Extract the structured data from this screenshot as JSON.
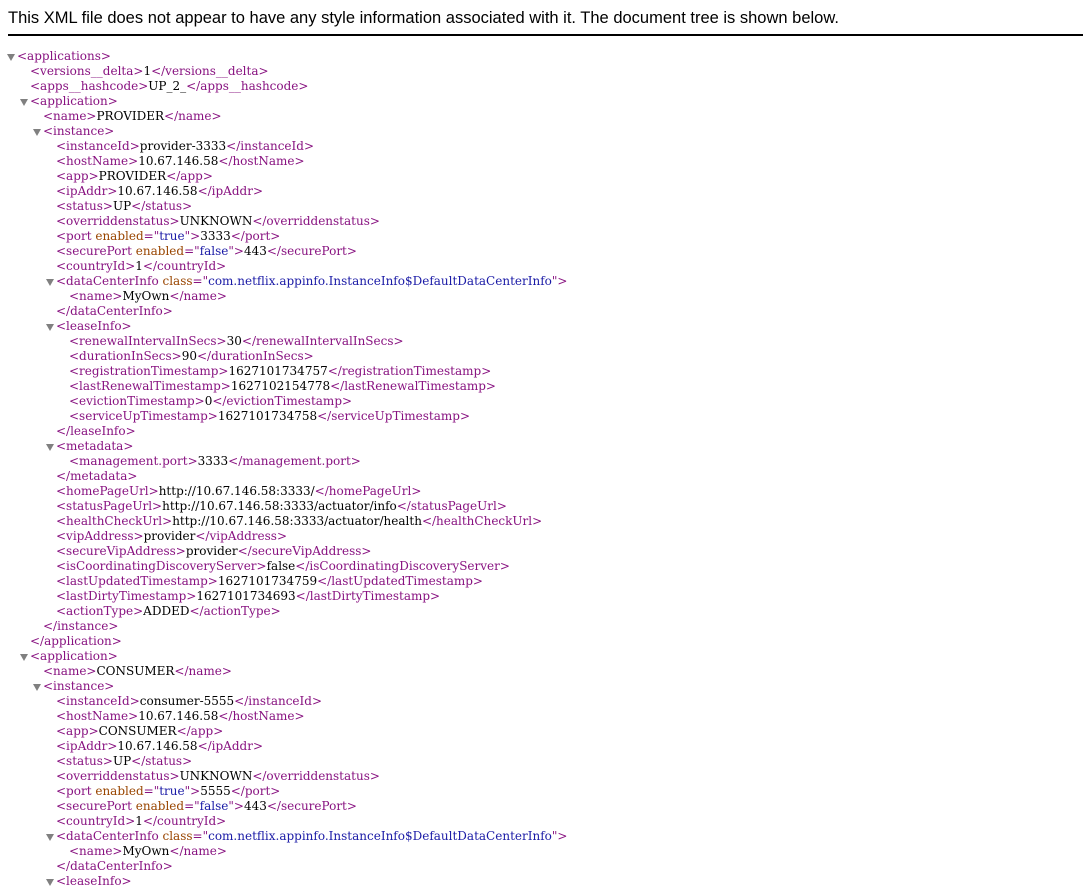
{
  "header": {
    "message": "This XML file does not appear to have any style information associated with it. The document tree is shown below."
  },
  "lines": [
    {
      "indent": 0,
      "toggle": true,
      "name": "applications-open",
      "parts": [
        {
          "c": "t",
          "s": "<applications>"
        }
      ]
    },
    {
      "indent": 1,
      "toggle": false,
      "name": "versions-delta",
      "parts": [
        {
          "c": "t",
          "s": "<versions__delta>"
        },
        {
          "c": "x",
          "s": "1"
        },
        {
          "c": "t",
          "s": "</versions__delta>"
        }
      ]
    },
    {
      "indent": 1,
      "toggle": false,
      "name": "apps-hashcode",
      "parts": [
        {
          "c": "t",
          "s": "<apps__hashcode>"
        },
        {
          "c": "x",
          "s": "UP_2_"
        },
        {
          "c": "t",
          "s": "</apps__hashcode>"
        }
      ]
    },
    {
      "indent": 1,
      "toggle": true,
      "name": "application-open",
      "parts": [
        {
          "c": "t",
          "s": "<application>"
        }
      ]
    },
    {
      "indent": 2,
      "toggle": false,
      "name": "name",
      "parts": [
        {
          "c": "t",
          "s": "<name>"
        },
        {
          "c": "x",
          "s": "PROVIDER"
        },
        {
          "c": "t",
          "s": "</name>"
        }
      ]
    },
    {
      "indent": 2,
      "toggle": true,
      "name": "instance-open",
      "parts": [
        {
          "c": "t",
          "s": "<instance>"
        }
      ]
    },
    {
      "indent": 3,
      "toggle": false,
      "name": "instance-id",
      "parts": [
        {
          "c": "t",
          "s": "<instanceId>"
        },
        {
          "c": "x",
          "s": "provider-3333"
        },
        {
          "c": "t",
          "s": "</instanceId>"
        }
      ]
    },
    {
      "indent": 3,
      "toggle": false,
      "name": "host-name",
      "parts": [
        {
          "c": "t",
          "s": "<hostName>"
        },
        {
          "c": "x",
          "s": "10.67.146.58"
        },
        {
          "c": "t",
          "s": "</hostName>"
        }
      ]
    },
    {
      "indent": 3,
      "toggle": false,
      "name": "app",
      "parts": [
        {
          "c": "t",
          "s": "<app>"
        },
        {
          "c": "x",
          "s": "PROVIDER"
        },
        {
          "c": "t",
          "s": "</app>"
        }
      ]
    },
    {
      "indent": 3,
      "toggle": false,
      "name": "ip-addr",
      "parts": [
        {
          "c": "t",
          "s": "<ipAddr>"
        },
        {
          "c": "x",
          "s": "10.67.146.58"
        },
        {
          "c": "t",
          "s": "</ipAddr>"
        }
      ]
    },
    {
      "indent": 3,
      "toggle": false,
      "name": "status",
      "parts": [
        {
          "c": "t",
          "s": "<status>"
        },
        {
          "c": "x",
          "s": "UP"
        },
        {
          "c": "t",
          "s": "</status>"
        }
      ]
    },
    {
      "indent": 3,
      "toggle": false,
      "name": "overridden-status",
      "parts": [
        {
          "c": "t",
          "s": "<overriddenstatus>"
        },
        {
          "c": "x",
          "s": "UNKNOWN"
        },
        {
          "c": "t",
          "s": "</overriddenstatus>"
        }
      ]
    },
    {
      "indent": 3,
      "toggle": false,
      "name": "port",
      "parts": [
        {
          "c": "t",
          "s": "<port"
        },
        {
          "c": "a",
          "s": " enabled"
        },
        {
          "c": "t",
          "s": "=\""
        },
        {
          "c": "v",
          "s": "true"
        },
        {
          "c": "t",
          "s": "\">"
        },
        {
          "c": "x",
          "s": "3333"
        },
        {
          "c": "t",
          "s": "</port>"
        }
      ]
    },
    {
      "indent": 3,
      "toggle": false,
      "name": "secure-port",
      "parts": [
        {
          "c": "t",
          "s": "<securePort"
        },
        {
          "c": "a",
          "s": " enabled"
        },
        {
          "c": "t",
          "s": "=\""
        },
        {
          "c": "v",
          "s": "false"
        },
        {
          "c": "t",
          "s": "\">"
        },
        {
          "c": "x",
          "s": "443"
        },
        {
          "c": "t",
          "s": "</securePort>"
        }
      ]
    },
    {
      "indent": 3,
      "toggle": false,
      "name": "country-id",
      "parts": [
        {
          "c": "t",
          "s": "<countryId>"
        },
        {
          "c": "x",
          "s": "1"
        },
        {
          "c": "t",
          "s": "</countryId>"
        }
      ]
    },
    {
      "indent": 3,
      "toggle": true,
      "name": "data-center-info-open",
      "parts": [
        {
          "c": "t",
          "s": "<dataCenterInfo"
        },
        {
          "c": "a",
          "s": " class"
        },
        {
          "c": "t",
          "s": "=\""
        },
        {
          "c": "v",
          "s": "com.netflix.appinfo.InstanceInfo$DefaultDataCenterInfo"
        },
        {
          "c": "t",
          "s": "\">"
        }
      ]
    },
    {
      "indent": 4,
      "toggle": false,
      "name": "data-center-name",
      "parts": [
        {
          "c": "t",
          "s": "<name>"
        },
        {
          "c": "x",
          "s": "MyOwn"
        },
        {
          "c": "t",
          "s": "</name>"
        }
      ]
    },
    {
      "indent": 3,
      "toggle": false,
      "name": "data-center-info-close",
      "parts": [
        {
          "c": "t",
          "s": "</dataCenterInfo>"
        }
      ]
    },
    {
      "indent": 3,
      "toggle": true,
      "name": "lease-info-open",
      "parts": [
        {
          "c": "t",
          "s": "<leaseInfo>"
        }
      ]
    },
    {
      "indent": 4,
      "toggle": false,
      "name": "renewal-interval",
      "parts": [
        {
          "c": "t",
          "s": "<renewalIntervalInSecs>"
        },
        {
          "c": "x",
          "s": "30"
        },
        {
          "c": "t",
          "s": "</renewalIntervalInSecs>"
        }
      ]
    },
    {
      "indent": 4,
      "toggle": false,
      "name": "duration",
      "parts": [
        {
          "c": "t",
          "s": "<durationInSecs>"
        },
        {
          "c": "x",
          "s": "90"
        },
        {
          "c": "t",
          "s": "</durationInSecs>"
        }
      ]
    },
    {
      "indent": 4,
      "toggle": false,
      "name": "registration-timestamp",
      "parts": [
        {
          "c": "t",
          "s": "<registrationTimestamp>"
        },
        {
          "c": "x",
          "s": "1627101734757"
        },
        {
          "c": "t",
          "s": "</registrationTimestamp>"
        }
      ]
    },
    {
      "indent": 4,
      "toggle": false,
      "name": "last-renewal-timestamp",
      "parts": [
        {
          "c": "t",
          "s": "<lastRenewalTimestamp>"
        },
        {
          "c": "x",
          "s": "1627102154778"
        },
        {
          "c": "t",
          "s": "</lastRenewalTimestamp>"
        }
      ]
    },
    {
      "indent": 4,
      "toggle": false,
      "name": "eviction-timestamp",
      "parts": [
        {
          "c": "t",
          "s": "<evictionTimestamp>"
        },
        {
          "c": "x",
          "s": "0"
        },
        {
          "c": "t",
          "s": "</evictionTimestamp>"
        }
      ]
    },
    {
      "indent": 4,
      "toggle": false,
      "name": "service-up-timestamp",
      "parts": [
        {
          "c": "t",
          "s": "<serviceUpTimestamp>"
        },
        {
          "c": "x",
          "s": "1627101734758"
        },
        {
          "c": "t",
          "s": "</serviceUpTimestamp>"
        }
      ]
    },
    {
      "indent": 3,
      "toggle": false,
      "name": "lease-info-close",
      "parts": [
        {
          "c": "t",
          "s": "</leaseInfo>"
        }
      ]
    },
    {
      "indent": 3,
      "toggle": true,
      "name": "metadata-open",
      "parts": [
        {
          "c": "t",
          "s": "<metadata>"
        }
      ]
    },
    {
      "indent": 4,
      "toggle": false,
      "name": "management-port",
      "parts": [
        {
          "c": "t",
          "s": "<management.port>"
        },
        {
          "c": "x",
          "s": "3333"
        },
        {
          "c": "t",
          "s": "</management.port>"
        }
      ]
    },
    {
      "indent": 3,
      "toggle": false,
      "name": "metadata-close",
      "parts": [
        {
          "c": "t",
          "s": "</metadata>"
        }
      ]
    },
    {
      "indent": 3,
      "toggle": false,
      "name": "home-page-url",
      "parts": [
        {
          "c": "t",
          "s": "<homePageUrl>"
        },
        {
          "c": "x",
          "s": "http://10.67.146.58:3333/"
        },
        {
          "c": "t",
          "s": "</homePageUrl>"
        }
      ]
    },
    {
      "indent": 3,
      "toggle": false,
      "name": "status-page-url",
      "parts": [
        {
          "c": "t",
          "s": "<statusPageUrl>"
        },
        {
          "c": "x",
          "s": "http://10.67.146.58:3333/actuator/info"
        },
        {
          "c": "t",
          "s": "</statusPageUrl>"
        }
      ]
    },
    {
      "indent": 3,
      "toggle": false,
      "name": "health-check-url",
      "parts": [
        {
          "c": "t",
          "s": "<healthCheckUrl>"
        },
        {
          "c": "x",
          "s": "http://10.67.146.58:3333/actuator/health"
        },
        {
          "c": "t",
          "s": "</healthCheckUrl>"
        }
      ]
    },
    {
      "indent": 3,
      "toggle": false,
      "name": "vip-address",
      "parts": [
        {
          "c": "t",
          "s": "<vipAddress>"
        },
        {
          "c": "x",
          "s": "provider"
        },
        {
          "c": "t",
          "s": "</vipAddress>"
        }
      ]
    },
    {
      "indent": 3,
      "toggle": false,
      "name": "secure-vip-address",
      "parts": [
        {
          "c": "t",
          "s": "<secureVipAddress>"
        },
        {
          "c": "x",
          "s": "provider"
        },
        {
          "c": "t",
          "s": "</secureVipAddress>"
        }
      ]
    },
    {
      "indent": 3,
      "toggle": false,
      "name": "is-coordinating-discovery-server",
      "parts": [
        {
          "c": "t",
          "s": "<isCoordinatingDiscoveryServer>"
        },
        {
          "c": "x",
          "s": "false"
        },
        {
          "c": "t",
          "s": "</isCoordinatingDiscoveryServer>"
        }
      ]
    },
    {
      "indent": 3,
      "toggle": false,
      "name": "last-updated-timestamp",
      "parts": [
        {
          "c": "t",
          "s": "<lastUpdatedTimestamp>"
        },
        {
          "c": "x",
          "s": "1627101734759"
        },
        {
          "c": "t",
          "s": "</lastUpdatedTimestamp>"
        }
      ]
    },
    {
      "indent": 3,
      "toggle": false,
      "name": "last-dirty-timestamp",
      "parts": [
        {
          "c": "t",
          "s": "<lastDirtyTimestamp>"
        },
        {
          "c": "x",
          "s": "1627101734693"
        },
        {
          "c": "t",
          "s": "</lastDirtyTimestamp>"
        }
      ]
    },
    {
      "indent": 3,
      "toggle": false,
      "name": "action-type",
      "parts": [
        {
          "c": "t",
          "s": "<actionType>"
        },
        {
          "c": "x",
          "s": "ADDED"
        },
        {
          "c": "t",
          "s": "</actionType>"
        }
      ]
    },
    {
      "indent": 2,
      "toggle": false,
      "name": "instance-close",
      "parts": [
        {
          "c": "t",
          "s": "</instance>"
        }
      ]
    },
    {
      "indent": 1,
      "toggle": false,
      "name": "application-close",
      "parts": [
        {
          "c": "t",
          "s": "</application>"
        }
      ]
    },
    {
      "indent": 1,
      "toggle": true,
      "name": "application-open",
      "parts": [
        {
          "c": "t",
          "s": "<application>"
        }
      ]
    },
    {
      "indent": 2,
      "toggle": false,
      "name": "name",
      "parts": [
        {
          "c": "t",
          "s": "<name>"
        },
        {
          "c": "x",
          "s": "CONSUMER"
        },
        {
          "c": "t",
          "s": "</name>"
        }
      ]
    },
    {
      "indent": 2,
      "toggle": true,
      "name": "instance-open",
      "parts": [
        {
          "c": "t",
          "s": "<instance>"
        }
      ]
    },
    {
      "indent": 3,
      "toggle": false,
      "name": "instance-id",
      "parts": [
        {
          "c": "t",
          "s": "<instanceId>"
        },
        {
          "c": "x",
          "s": "consumer-5555"
        },
        {
          "c": "t",
          "s": "</instanceId>"
        }
      ]
    },
    {
      "indent": 3,
      "toggle": false,
      "name": "host-name",
      "parts": [
        {
          "c": "t",
          "s": "<hostName>"
        },
        {
          "c": "x",
          "s": "10.67.146.58"
        },
        {
          "c": "t",
          "s": "</hostName>"
        }
      ]
    },
    {
      "indent": 3,
      "toggle": false,
      "name": "app",
      "parts": [
        {
          "c": "t",
          "s": "<app>"
        },
        {
          "c": "x",
          "s": "CONSUMER"
        },
        {
          "c": "t",
          "s": "</app>"
        }
      ]
    },
    {
      "indent": 3,
      "toggle": false,
      "name": "ip-addr",
      "parts": [
        {
          "c": "t",
          "s": "<ipAddr>"
        },
        {
          "c": "x",
          "s": "10.67.146.58"
        },
        {
          "c": "t",
          "s": "</ipAddr>"
        }
      ]
    },
    {
      "indent": 3,
      "toggle": false,
      "name": "status",
      "parts": [
        {
          "c": "t",
          "s": "<status>"
        },
        {
          "c": "x",
          "s": "UP"
        },
        {
          "c": "t",
          "s": "</status>"
        }
      ]
    },
    {
      "indent": 3,
      "toggle": false,
      "name": "overridden-status",
      "parts": [
        {
          "c": "t",
          "s": "<overriddenstatus>"
        },
        {
          "c": "x",
          "s": "UNKNOWN"
        },
        {
          "c": "t",
          "s": "</overriddenstatus>"
        }
      ]
    },
    {
      "indent": 3,
      "toggle": false,
      "name": "port",
      "parts": [
        {
          "c": "t",
          "s": "<port"
        },
        {
          "c": "a",
          "s": " enabled"
        },
        {
          "c": "t",
          "s": "=\""
        },
        {
          "c": "v",
          "s": "true"
        },
        {
          "c": "t",
          "s": "\">"
        },
        {
          "c": "x",
          "s": "5555"
        },
        {
          "c": "t",
          "s": "</port>"
        }
      ]
    },
    {
      "indent": 3,
      "toggle": false,
      "name": "secure-port",
      "parts": [
        {
          "c": "t",
          "s": "<securePort"
        },
        {
          "c": "a",
          "s": " enabled"
        },
        {
          "c": "t",
          "s": "=\""
        },
        {
          "c": "v",
          "s": "false"
        },
        {
          "c": "t",
          "s": "\">"
        },
        {
          "c": "x",
          "s": "443"
        },
        {
          "c": "t",
          "s": "</securePort>"
        }
      ]
    },
    {
      "indent": 3,
      "toggle": false,
      "name": "country-id",
      "parts": [
        {
          "c": "t",
          "s": "<countryId>"
        },
        {
          "c": "x",
          "s": "1"
        },
        {
          "c": "t",
          "s": "</countryId>"
        }
      ]
    },
    {
      "indent": 3,
      "toggle": true,
      "name": "data-center-info-open",
      "parts": [
        {
          "c": "t",
          "s": "<dataCenterInfo"
        },
        {
          "c": "a",
          "s": " class"
        },
        {
          "c": "t",
          "s": "=\""
        },
        {
          "c": "v",
          "s": "com.netflix.appinfo.InstanceInfo$DefaultDataCenterInfo"
        },
        {
          "c": "t",
          "s": "\">"
        }
      ]
    },
    {
      "indent": 4,
      "toggle": false,
      "name": "data-center-name",
      "parts": [
        {
          "c": "t",
          "s": "<name>"
        },
        {
          "c": "x",
          "s": "MyOwn"
        },
        {
          "c": "t",
          "s": "</name>"
        }
      ]
    },
    {
      "indent": 3,
      "toggle": false,
      "name": "data-center-info-close",
      "parts": [
        {
          "c": "t",
          "s": "</dataCenterInfo>"
        }
      ]
    },
    {
      "indent": 3,
      "toggle": true,
      "name": "lease-info-open",
      "parts": [
        {
          "c": "t",
          "s": "<leaseInfo>"
        }
      ]
    }
  ]
}
